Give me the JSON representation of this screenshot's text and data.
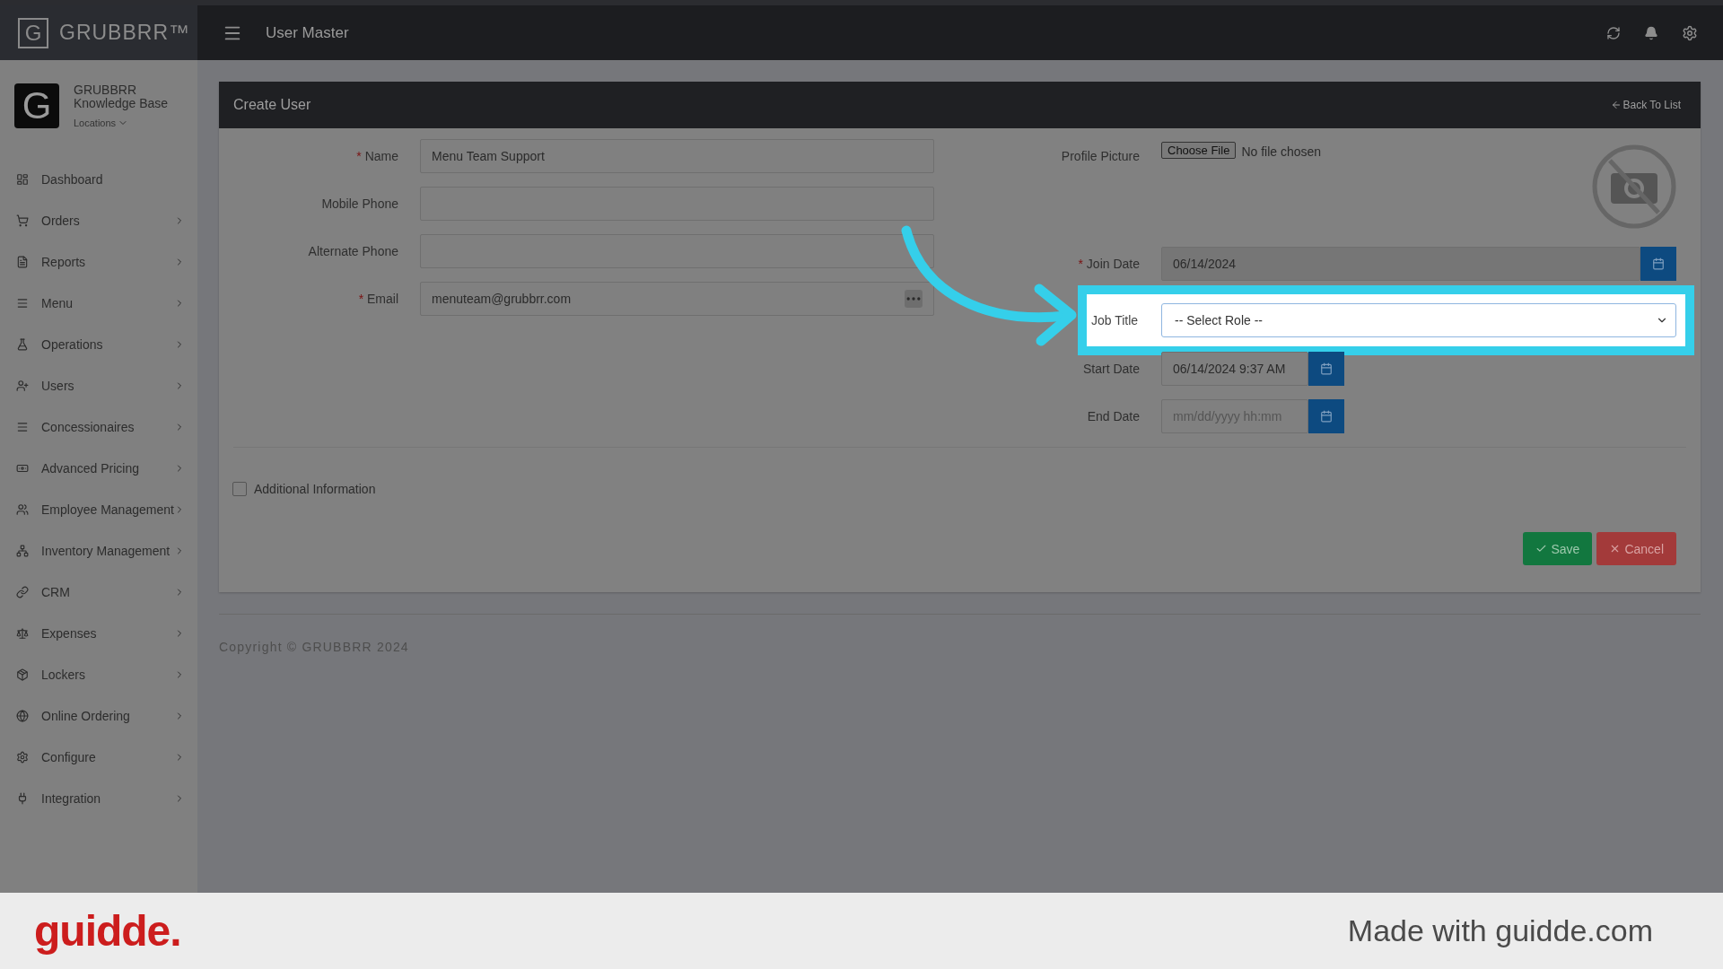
{
  "topbar": {
    "logo_letter": "G",
    "brand": "GRUBBRR™",
    "title": "User Master"
  },
  "account": {
    "logo_letter": "G",
    "name": "GRUBBRR Knowledge Base",
    "locations": "Locations"
  },
  "sidebar": {
    "items": [
      {
        "label": "Dashboard",
        "has_submenu": false
      },
      {
        "label": "Orders",
        "has_submenu": true
      },
      {
        "label": "Reports",
        "has_submenu": true
      },
      {
        "label": "Menu",
        "has_submenu": true
      },
      {
        "label": "Operations",
        "has_submenu": true
      },
      {
        "label": "Users",
        "has_submenu": true
      },
      {
        "label": "Concessionaires",
        "has_submenu": true
      },
      {
        "label": "Advanced Pricing",
        "has_submenu": true
      },
      {
        "label": "Employee Management",
        "has_submenu": true
      },
      {
        "label": "Inventory Management",
        "has_submenu": true
      },
      {
        "label": "CRM",
        "has_submenu": true
      },
      {
        "label": "Expenses",
        "has_submenu": true
      },
      {
        "label": "Lockers",
        "has_submenu": true
      },
      {
        "label": "Online Ordering",
        "has_submenu": true
      },
      {
        "label": "Configure",
        "has_submenu": true
      },
      {
        "label": "Integration",
        "has_submenu": true
      }
    ]
  },
  "card": {
    "title": "Create User",
    "back_link": "Back To List"
  },
  "left_fields": [
    {
      "label": "Name",
      "required_mark": "*",
      "value": "Menu Team Support",
      "kind": "text"
    },
    {
      "label": "Mobile Phone",
      "kind": "text"
    },
    {
      "label": "Alternate Phone",
      "kind": "text"
    },
    {
      "label": "Email",
      "required_mark": "*",
      "value": "menuteam@grubbrr.com",
      "kind": "email"
    }
  ],
  "profile_picture": {
    "label": "Profile Picture",
    "button": "Choose File",
    "status": "No file chosen"
  },
  "join_date": {
    "label": "Join Date",
    "required_mark": "*",
    "value": "06/14/2024"
  },
  "job_title": {
    "label": "Job Title",
    "placeholder": "-- Select Role --",
    "highlighted": true
  },
  "start_date": {
    "label": "Start Date",
    "value": "06/14/2024 9:37 AM"
  },
  "end_date": {
    "label": "End Date",
    "placeholder": "mm/dd/yyyy hh:mm"
  },
  "additional_info": {
    "label": "Additional Information",
    "checked": false
  },
  "actions": [
    {
      "label": "Save",
      "kind": "save"
    },
    {
      "label": "Cancel",
      "kind": "cancel"
    }
  ],
  "copyright": "Copyright © GRUBBRR 2024",
  "guidde": {
    "logo": "guidde.",
    "note": "Made with guidde.com"
  }
}
